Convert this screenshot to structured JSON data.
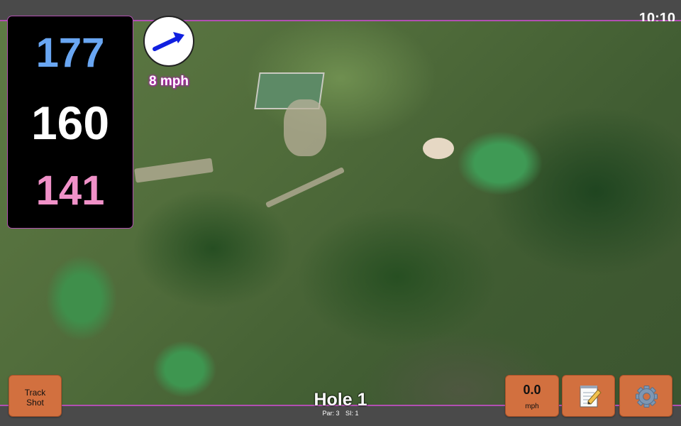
{
  "status": {
    "time": "10:10"
  },
  "distances": {
    "back": "177",
    "middle": "160",
    "front": "141"
  },
  "wind": {
    "speed_label": "8 mph",
    "icon": "wind-direction-arrow-icon",
    "direction": "east-northeast"
  },
  "buttons": {
    "track_shot_line1": "Track",
    "track_shot_line2": "Shot",
    "speed_value": "0.0",
    "speed_unit": "mph",
    "notes_icon": "notepad-icon",
    "settings_icon": "gear-icon"
  },
  "hole": {
    "title": "Hole 1",
    "par_label": "Par: 3",
    "si_label": "SI: 1"
  },
  "colors": {
    "accent": "#b24fb2",
    "back_distance": "#69a6f2",
    "middle_distance": "#ffffff",
    "front_distance": "#f091c8",
    "button": "#d2703f",
    "wind_arrow": "#1020e0"
  }
}
